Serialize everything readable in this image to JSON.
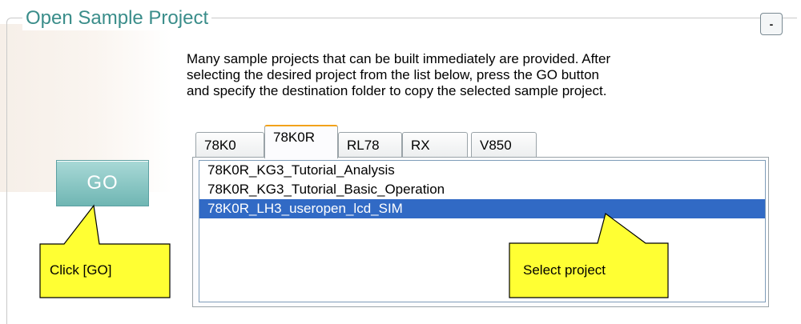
{
  "group": {
    "title": "Open Sample Project",
    "collapse_label": "-"
  },
  "description": {
    "lines": [
      "Many sample projects that can be built immediately are provided. After",
      "selecting the desired project from the list below, press the GO button",
      "and specify the destination folder to copy the selected sample project."
    ]
  },
  "tabs": [
    {
      "label": "78K0",
      "active": false
    },
    {
      "label": "78K0R",
      "active": true
    },
    {
      "label": "RL78",
      "active": false
    },
    {
      "label": "RX",
      "active": false
    },
    {
      "label": "V850",
      "active": false
    }
  ],
  "project_list": {
    "items": [
      {
        "label": "78K0R_KG3_Tutorial_Analysis",
        "selected": false
      },
      {
        "label": "78K0R_KG3_Tutorial_Basic_Operation",
        "selected": false
      },
      {
        "label": "78K0R_LH3_useropen_lcd_SIM",
        "selected": true
      }
    ]
  },
  "go_button": {
    "label": "GO"
  },
  "callouts": {
    "go": "Click [GO]",
    "select": "Select project"
  },
  "colors": {
    "title": "#3a8d8a",
    "selection": "#316ac5",
    "callout_fill": "#ffff33",
    "active_tab_accent": "#f2a21a",
    "go_button": "#7fc0bd"
  }
}
